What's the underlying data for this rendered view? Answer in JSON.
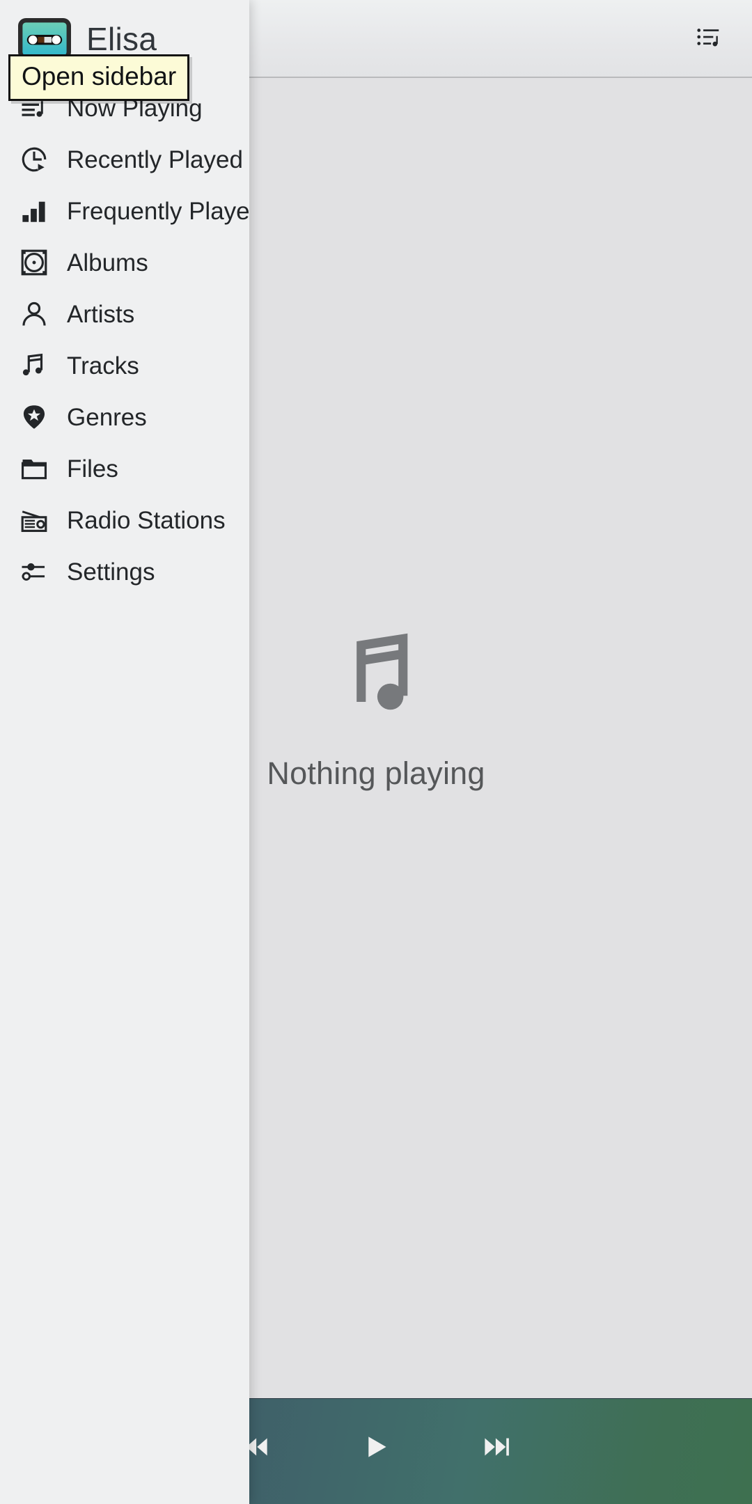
{
  "app": {
    "title": "Elisa",
    "logo_icon": "cassette-tape-icon",
    "logo_colors": {
      "shell_top": "#6fd0b4",
      "shell_bottom": "#2fb6cd",
      "outline": "#2b2b2b",
      "tape_window": "#5b2f10",
      "reel": "#ffffff"
    }
  },
  "tooltip": {
    "text": "Open sidebar",
    "background": "#fcfbd7",
    "border": "#121212"
  },
  "header": {
    "playlist_button_label": "Playlist",
    "playlist_icon": "playlist-music-icon"
  },
  "sidebar": {
    "items": [
      {
        "label": "Now Playing",
        "icon": "now-playing-icon",
        "key": "now-playing"
      },
      {
        "label": "Recently Played",
        "icon": "clock-play-icon",
        "key": "recently-played"
      },
      {
        "label": "Frequently Played",
        "icon": "bar-chart-icon",
        "key": "frequently-played"
      },
      {
        "label": "Albums",
        "icon": "album-disc-icon",
        "key": "albums"
      },
      {
        "label": "Artists",
        "icon": "person-icon",
        "key": "artists"
      },
      {
        "label": "Tracks",
        "icon": "music-note-icon",
        "key": "tracks"
      },
      {
        "label": "Genres",
        "icon": "guitar-pick-star-icon",
        "key": "genres"
      },
      {
        "label": "Files",
        "icon": "folder-icon",
        "key": "files"
      },
      {
        "label": "Radio Stations",
        "icon": "radio-icon",
        "key": "radio-stations"
      },
      {
        "label": "Settings",
        "icon": "sliders-icon",
        "key": "settings"
      }
    ]
  },
  "main": {
    "empty_state_text": "Nothing playing",
    "empty_state_icon": "beamed-eighth-notes-icon",
    "background": "#e1e1e3"
  },
  "player": {
    "previous_label": "Previous Track",
    "play_label": "Play",
    "next_label": "Next Track",
    "previous_icon": "skip-backward-icon",
    "play_icon": "play-icon",
    "next_icon": "skip-forward-icon",
    "gradient_start": "#41596b",
    "gradient_end": "#3e7050",
    "control_color": "#f0f0f0"
  }
}
